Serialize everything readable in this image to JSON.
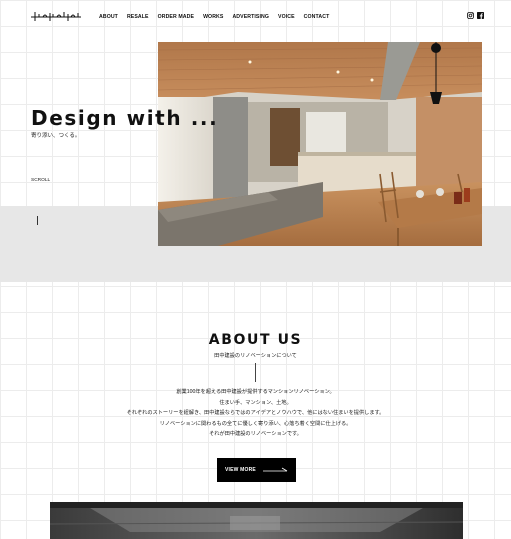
{
  "header": {
    "logo_alt": "tanaka logo",
    "nav": [
      "ABOUT",
      "RESALE",
      "ORDER MADE",
      "WORKS",
      "ADVERTISING",
      "VOICE",
      "CONTACT"
    ],
    "social_icons": [
      "instagram-icon",
      "facebook-icon"
    ]
  },
  "hero": {
    "title": "Design with ...",
    "subtitle": "寄り添い、つくる。",
    "scroll_label": "SCROLL",
    "photo": "renovated-kitchen-dining-photo"
  },
  "about": {
    "title": "ABOUT US",
    "subtitle": "田中建設のリノベーションについて",
    "lines": [
      "創業100年を超える田中建設が提供するマンションリノベーション。",
      "住まい手、マンション、土地。",
      "それぞれのストーリーを紐解き、田中建設ならではのアイデアとノウハウで、他にはない住まいを提供します。",
      "リノベーションに関わるもの全てに優しく寄り添い、心落ち着く空間に仕上げる。",
      "それが田中建設のリノベーションです。"
    ],
    "button_label": "VIEW MORE"
  },
  "colors": {
    "text": "#111111",
    "band": "#e7e7e7",
    "button_bg": "#000000",
    "button_text": "#ffffff"
  }
}
